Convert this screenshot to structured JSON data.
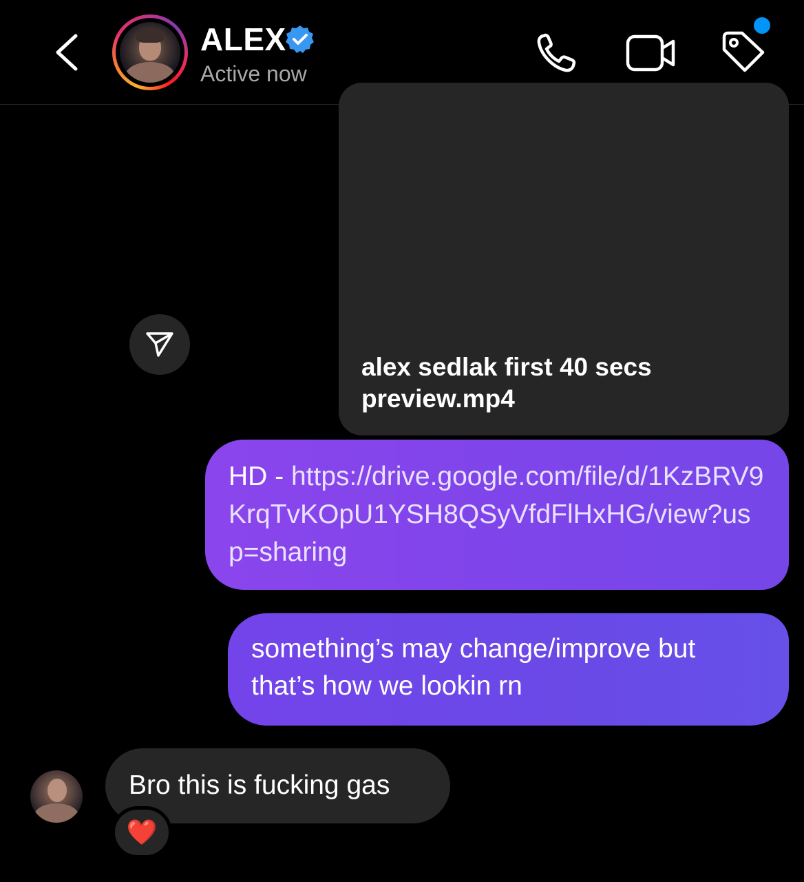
{
  "header": {
    "name": "ALEX",
    "status": "Active now",
    "icons": {
      "back": "chevron-left-icon",
      "verified": "verified-badge-icon",
      "call": "phone-icon",
      "video": "video-camera-icon",
      "tag": "tag-icon"
    },
    "notification_dot_color": "#0095f6"
  },
  "messages": {
    "video": {
      "title": "alex sedlak first 40 secs preview.mp4"
    },
    "link": {
      "prefix": "HD - ",
      "url": "https://drive.google.com/file/d/1KzBRV9KrqTvKOpU1YSH8QSyVfdFlHxHG/view?usp=sharing"
    },
    "text_out": "something’s may change/improve but that’s how we lookin rn",
    "text_in": "Bro this is fucking gas",
    "reaction": "❤️"
  },
  "colors": {
    "background": "#000000",
    "incoming_bubble": "#262626",
    "outgoing_gradient_start": "#8b45ec",
    "outgoing_gradient_end": "#6650e8"
  }
}
